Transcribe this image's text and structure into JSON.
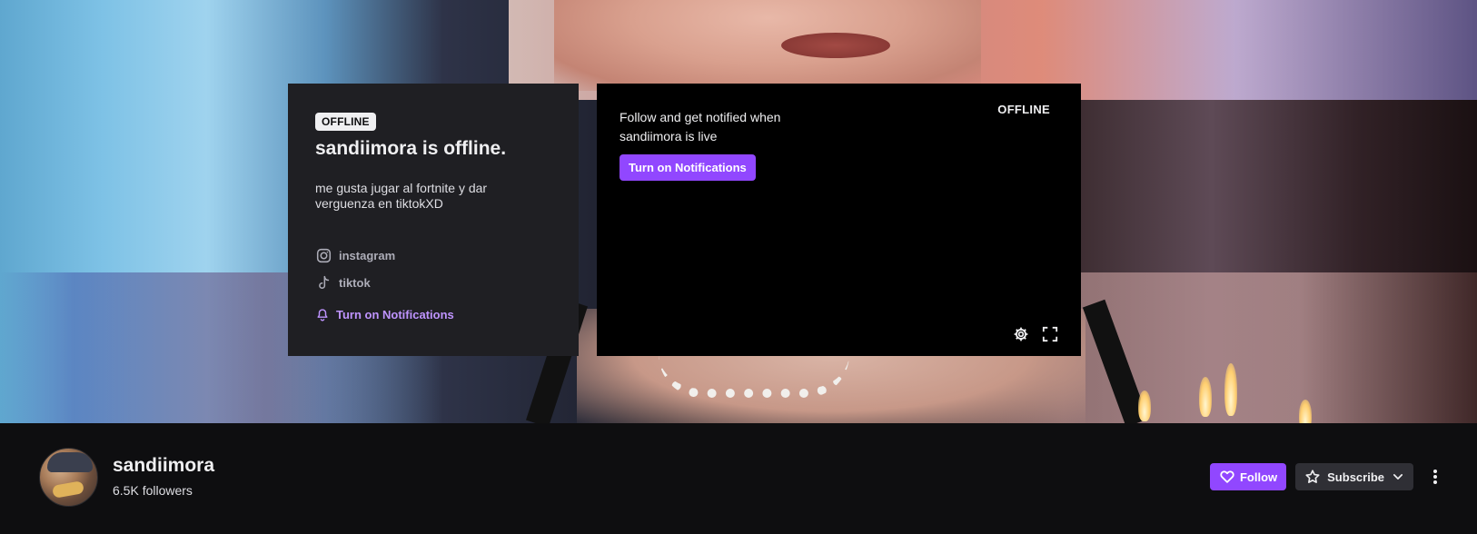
{
  "info_card": {
    "offline_badge": "OFFLINE",
    "title": "sandiimora is offline.",
    "bio": "me gusta jugar al fortnite y dar verguenza en tiktokXD",
    "socials": [
      {
        "label": "instagram",
        "icon": "instagram-icon"
      },
      {
        "label": "tiktok",
        "icon": "tiktok-icon"
      }
    ],
    "notify_label": "Turn on Notifications",
    "notify_icon": "bell-icon"
  },
  "player": {
    "prompt": "Follow and get notified when sandiimora is live",
    "notify_button": "Turn on Notifications",
    "status": "OFFLINE",
    "controls": [
      "settings-icon",
      "fullscreen-icon"
    ]
  },
  "channel": {
    "name": "sandiimora",
    "followers": "6.5K followers",
    "follow_label": "Follow",
    "subscribe_label": "Subscribe"
  },
  "colors": {
    "accent": "#9147ff",
    "accent_text": "#bf94ff",
    "card_bg": "#1f1f23",
    "page_bg": "#0e0e10"
  }
}
